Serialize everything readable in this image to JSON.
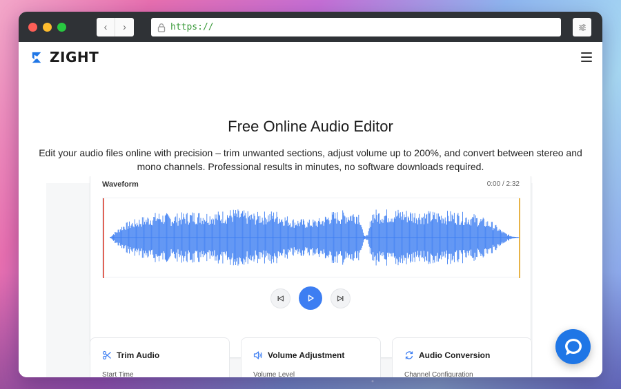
{
  "browser": {
    "url": "https://",
    "back_glyph": "‹",
    "forward_glyph": "›"
  },
  "brand": {
    "name": "ZIGHT",
    "color": "#1f76e6"
  },
  "hero": {
    "title": "Free Online Audio Editor",
    "description": "Edit your audio files online with precision – trim unwanted sections, adjust volume up to 200%, and convert between stereo and mono channels. Professional results in minutes, no software downloads required."
  },
  "waveform": {
    "label": "Waveform",
    "current_time": "0:00",
    "separator": "/",
    "duration": "2:32",
    "color": "#3d7ef2",
    "start_marker_color": "#d93a2b",
    "end_marker_color": "#e3a21a"
  },
  "controls": {
    "skip_back_icon": "skip-back-icon",
    "play_icon": "play-icon",
    "skip_forward_icon": "skip-forward-icon",
    "play_color": "#3d7ef2"
  },
  "tools": [
    {
      "title": "Trim Audio",
      "subtitle": "Start Time",
      "icon": "scissors-icon"
    },
    {
      "title": "Volume Adjustment",
      "subtitle": "Volume Level",
      "icon": "speaker-icon"
    },
    {
      "title": "Audio Conversion",
      "subtitle": "Channel Configuration",
      "icon": "refresh-icon"
    }
  ],
  "chat": {
    "icon": "chat-bubble-icon",
    "color": "#1f76e6"
  }
}
